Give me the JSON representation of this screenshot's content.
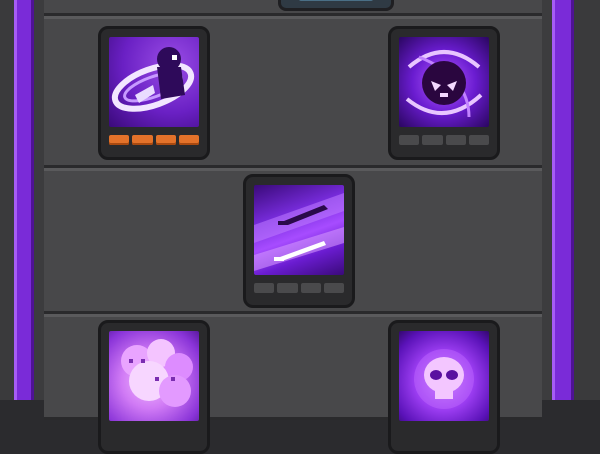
{
  "screen": {
    "accent_color": "#7a2bd8",
    "pip_on_color": "#e3722a"
  },
  "skill_rows": [
    {
      "skills": [
        {
          "icon": "whirlwind-slash-icon",
          "level": 4,
          "max_level": 4
        },
        {
          "icon": "shadow-vortex-icon",
          "level": 0,
          "max_level": 4
        }
      ]
    },
    {
      "skills": [
        {
          "icon": "twin-daggers-icon",
          "level": 0,
          "max_level": 4
        }
      ]
    },
    {
      "skills": [
        {
          "icon": "poison-cloud-icon",
          "level": null,
          "max_level": null
        },
        {
          "icon": "glowing-skull-icon",
          "level": null,
          "max_level": null
        }
      ]
    }
  ]
}
